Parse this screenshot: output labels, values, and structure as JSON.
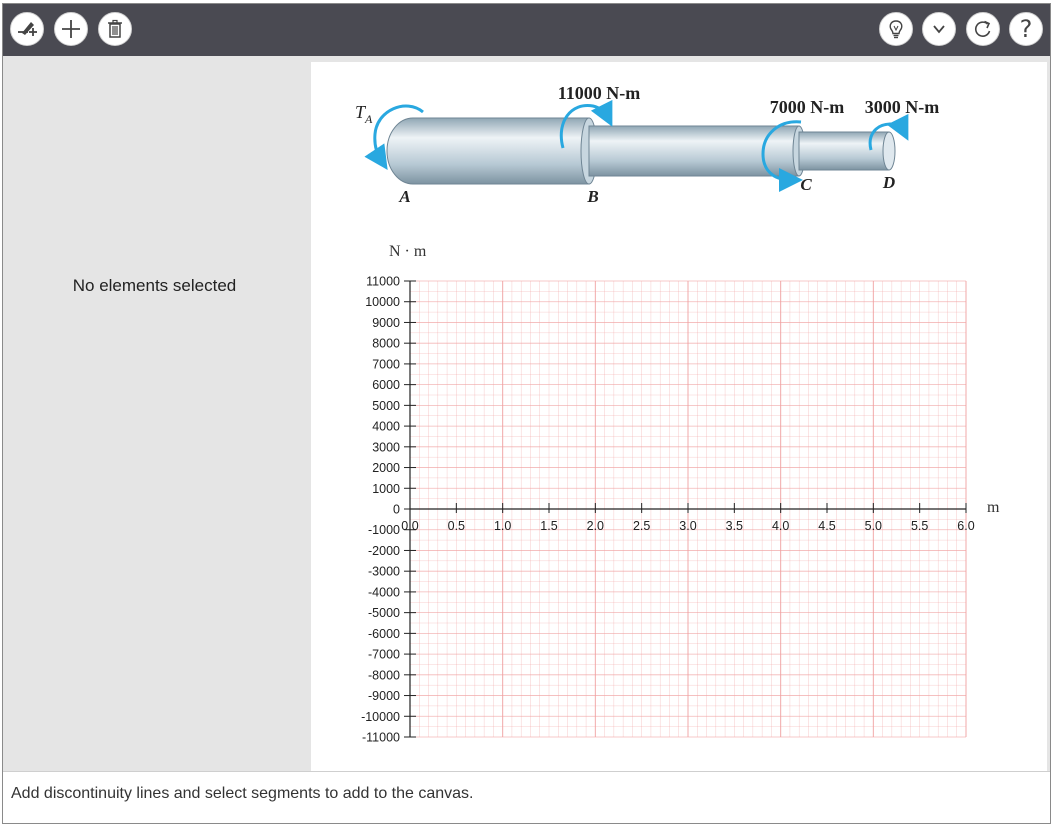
{
  "toolbar": {
    "left_tools": [
      {
        "name": "add-discontinuity-line",
        "icon": "pencil-plus-icon"
      },
      {
        "name": "add-segment",
        "icon": "plus-icon"
      },
      {
        "name": "delete",
        "icon": "trash-icon"
      }
    ],
    "right_tools": [
      {
        "name": "hint",
        "icon": "lightbulb-icon"
      },
      {
        "name": "more",
        "icon": "chevron-down-icon"
      },
      {
        "name": "reset",
        "icon": "refresh-icon"
      },
      {
        "name": "help",
        "icon": "question-mark-icon",
        "glyph": "?"
      }
    ]
  },
  "sidebar": {
    "selection_status": "No elements selected"
  },
  "figure": {
    "torques": {
      "TA": "T",
      "TA_sub": "A",
      "B": "11000 N-m",
      "C": "7000 N-m",
      "D": "3000 N-m"
    },
    "points": [
      "A",
      "B",
      "C",
      "D"
    ],
    "colors": {
      "shaft": "#b7c9d4",
      "arrow": "#29a8e0"
    }
  },
  "chart_data": {
    "type": "line",
    "ylabel": "N · m",
    "xlabel": "m",
    "xlim": [
      0,
      6
    ],
    "ylim": [
      -11000,
      11000
    ],
    "x_ticks": [
      "0.0",
      "0.5",
      "1.0",
      "1.5",
      "2.0",
      "2.5",
      "3.0",
      "3.5",
      "4.0",
      "4.5",
      "5.0",
      "5.5",
      "6.0"
    ],
    "y_ticks": [
      "11000",
      "10000",
      "9000",
      "8000",
      "7000",
      "6000",
      "5000",
      "4000",
      "3000",
      "2000",
      "1000",
      "0",
      "-1000",
      "-2000",
      "-3000",
      "-4000",
      "-5000",
      "-6000",
      "-7000",
      "-8000",
      "-9000",
      "-10000",
      "-11000"
    ],
    "grid": true,
    "grid_color": "#f0a0a0",
    "series": []
  },
  "status_bar": {
    "message": "Add discontinuity lines and select segments to add to the canvas."
  }
}
